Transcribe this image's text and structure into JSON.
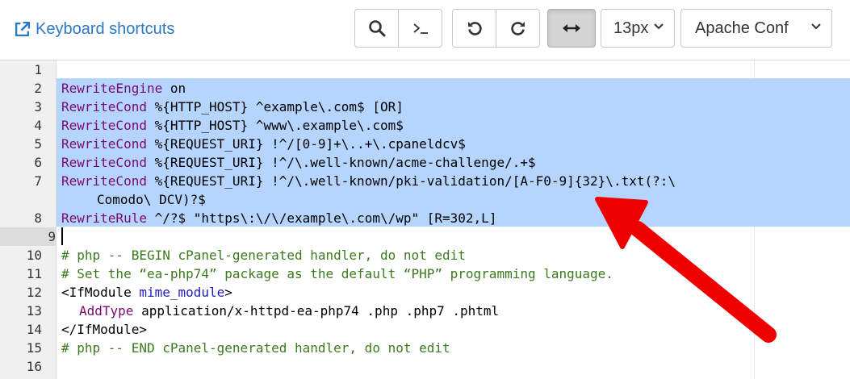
{
  "toolbar": {
    "keyboard_shortcuts_label": "Keyboard shortcuts",
    "font_size_value": "13px",
    "mode_value": "Apache Conf",
    "buttons": [
      "search-icon",
      "terminal-icon",
      "undo-icon",
      "redo-icon",
      "wrap-arrows-icon"
    ]
  },
  "editor": {
    "line_numbers": [
      "1",
      "2",
      "3",
      "4",
      "5",
      "6",
      "7",
      "8",
      "9",
      "10",
      "11",
      "12",
      "13",
      "14",
      "15",
      "16"
    ],
    "current_line": "9",
    "lines": {
      "l2": {
        "kw": "RewriteEngine",
        "rest": " on"
      },
      "l3": {
        "kw": "RewriteCond",
        "rest": " %{HTTP_HOST} ^example\\.com$ [OR]"
      },
      "l4": {
        "kw": "RewriteCond",
        "rest": " %{HTTP_HOST} ^www\\.example\\.com$"
      },
      "l5": {
        "kw": "RewriteCond",
        "rest": " %{REQUEST_URI} !^/[0-9]+\\..+\\.cpaneldcv$"
      },
      "l6": {
        "kw": "RewriteCond",
        "rest": " %{REQUEST_URI} !^/\\.well-known/acme-challenge/.+$"
      },
      "l7": {
        "kw": "RewriteCond",
        "rest": " %{REQUEST_URI} !^/\\.well-known/pki-validation/[A-F0-9]{32}\\.txt(?:\\"
      },
      "l7b": {
        "rest": "Comodo\\ DCV)?$"
      },
      "l8": {
        "kw": "RewriteRule",
        "rest": " ^/?$ \"https\\:\\/\\/example\\.com\\/wp\" [R=302,L]"
      },
      "l10": {
        "cm": "# php -- BEGIN cPanel-generated handler, do not edit"
      },
      "l11": {
        "cm": "# Set the “ea-php74” package as the default “PHP” programming language."
      },
      "l12": {
        "open": "<IfModule ",
        "attr": "mime_module",
        "close": ">"
      },
      "l13": {
        "kw": "AddType",
        "rest": " application/x-httpd-ea-php74 .php .php7 .phtml"
      },
      "l14": {
        "tag": "</IfModule>"
      },
      "l15": {
        "cm": "# php -- END cPanel-generated handler, do not edit"
      }
    }
  },
  "colors": {
    "link": "#2b78c5",
    "selection": "#b5d5ff",
    "keyword": "#7a0874",
    "comment": "#3b7a1d",
    "arrow": "#ee0000"
  }
}
